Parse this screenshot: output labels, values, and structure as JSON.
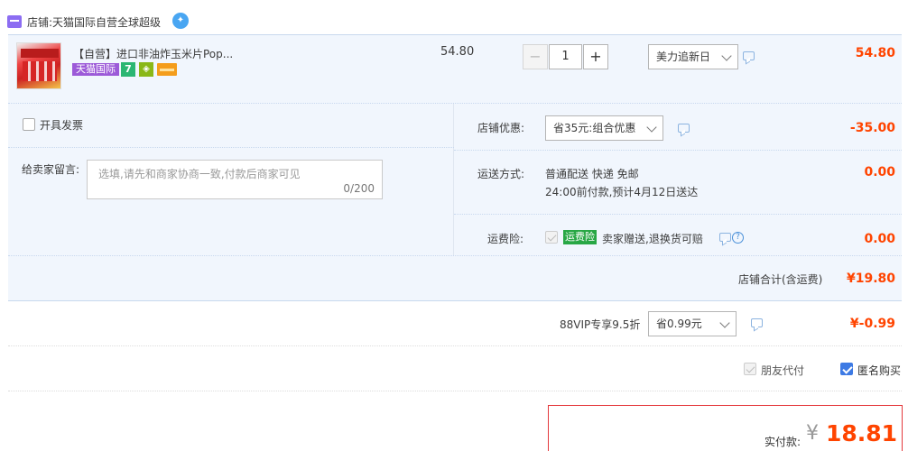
{
  "shop": {
    "label": "店铺:天猫国际自营全球超级",
    "icon": "shop-icon",
    "chat_icon": "wangwang-chat-icon"
  },
  "item": {
    "title": "【自营】进口非油炸玉米片Pop...",
    "tmall_badge": "天猫国际",
    "seven_day_badge": "7",
    "unit_price": "54.80",
    "quantity": "1",
    "qty_minus": "−",
    "qty_plus": "+",
    "variant": "美力追新日",
    "subtotal": "54.80"
  },
  "invoice": {
    "label": "开具发票"
  },
  "memo": {
    "label": "给卖家留言:",
    "placeholder": "选填,请先和商家协商一致,付款后商家可见",
    "counter": "0/200"
  },
  "shop_discount": {
    "label": "店铺优惠:",
    "selected": "省35元:组合优惠",
    "amount": "-35.00"
  },
  "shipping": {
    "label": "运送方式:",
    "method": "普通配送 快递 免邮",
    "eta": "24:00前付款,预计4月12日送达",
    "amount": "0.00"
  },
  "insurance": {
    "label": "运费险:",
    "badge": "运费险",
    "desc": "卖家赠送,退换货可赔",
    "help": "?",
    "amount": "0.00"
  },
  "shop_total": {
    "label": "店铺合计(含运费)",
    "amount": "¥19.80"
  },
  "vip": {
    "label": "88VIP专享9.5折",
    "selected": "省0.99元",
    "amount": "¥-0.99"
  },
  "friend_pay": {
    "label": "朋友代付"
  },
  "anonymous": {
    "label": "匿名购买"
  },
  "payment": {
    "label": "实付款:",
    "currency": "¥",
    "amount": "18.81"
  },
  "colors": {
    "accent_red": "#ff4400",
    "row_bg": "#f1f6fd",
    "tmall_purple": "#9c5ad8",
    "checkbox_blue": "#3d7ae4"
  }
}
